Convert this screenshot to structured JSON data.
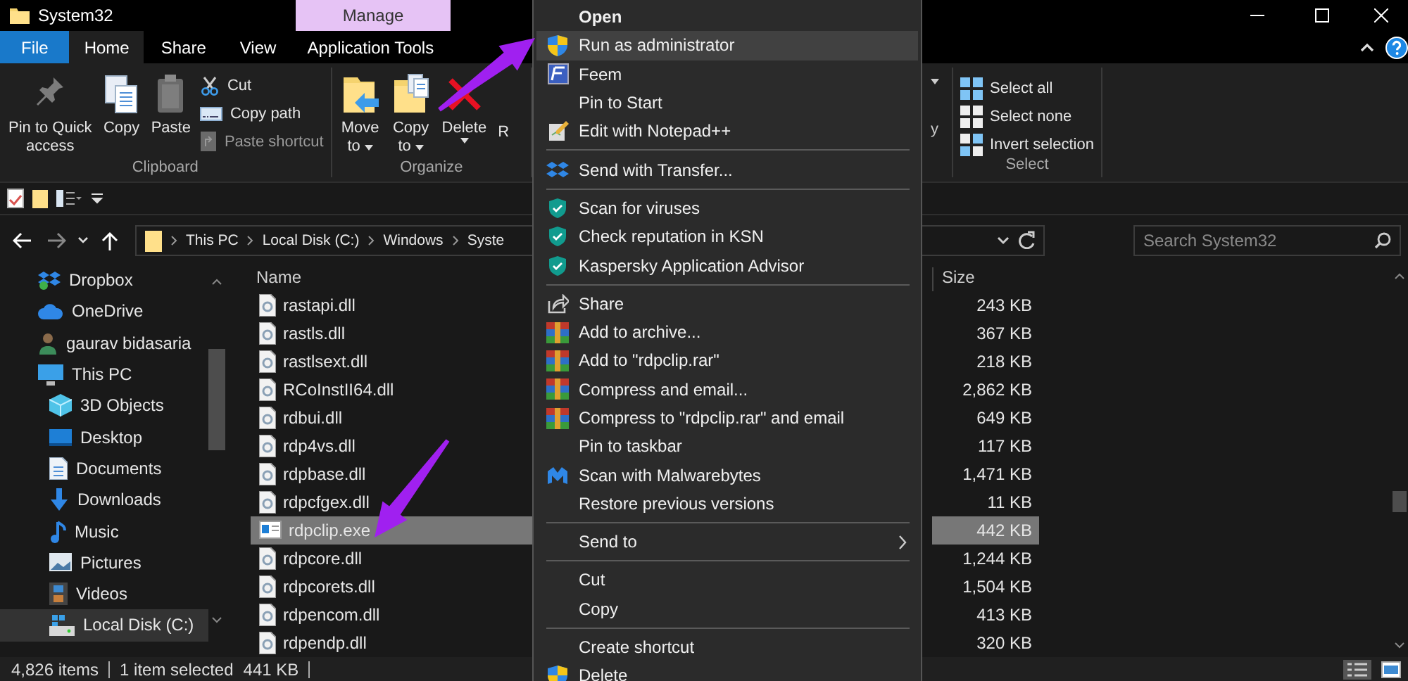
{
  "window": {
    "title": "System32",
    "context_header": "Manage"
  },
  "tabs": [
    {
      "label": "File",
      "kind": "file",
      "selected": false
    },
    {
      "label": "Home",
      "kind": "plain",
      "selected": true
    },
    {
      "label": "Share",
      "kind": "plain",
      "selected": false
    },
    {
      "label": "View",
      "kind": "plain",
      "selected": false
    },
    {
      "label": "Application Tools",
      "kind": "context",
      "selected": false
    }
  ],
  "ribbon": {
    "groups": [
      {
        "label": "Clipboard",
        "large": [
          {
            "label": "Pin to Quick access",
            "kind": "pin",
            "dropdown": false
          },
          {
            "label": "Copy",
            "kind": "copy",
            "dropdown": false
          },
          {
            "label": "Paste",
            "kind": "paste",
            "dropdown": false
          }
        ],
        "small": [
          {
            "label": "Cut",
            "kind": "scissors",
            "disabled": false
          },
          {
            "label": "Copy path",
            "kind": "path",
            "disabled": false
          },
          {
            "label": "Paste shortcut",
            "kind": "shortcut",
            "disabled": true
          }
        ]
      },
      {
        "label": "Organize",
        "large": [
          {
            "label": "Move to",
            "kind": "move",
            "dropdown": true
          },
          {
            "label": "Copy to",
            "kind": "copyto",
            "dropdown": true
          },
          {
            "label": "Delete",
            "kind": "delete",
            "dropdown": true
          },
          {
            "label": "R",
            "kind": "none",
            "dropdown": false
          }
        ]
      }
    ],
    "fragment": "y",
    "right_group": {
      "label": "Select",
      "small": [
        {
          "label": "Select all",
          "kind": "all",
          "disabled": false
        },
        {
          "label": "Select none",
          "kind": "none",
          "disabled": false
        },
        {
          "label": "Invert selection",
          "kind": "invert",
          "disabled": false
        }
      ]
    }
  },
  "address": {
    "crumbs": [
      "This PC",
      "Local Disk (C:)",
      "Windows",
      "Syste"
    ]
  },
  "search": {
    "placeholder": "Search System32"
  },
  "nav": {
    "items": [
      {
        "label": "Dropbox",
        "kind": "dropbox",
        "selected": false
      },
      {
        "label": "OneDrive",
        "kind": "cloud",
        "selected": false
      },
      {
        "label": "gaurav bidasaria",
        "kind": "user",
        "selected": false
      },
      {
        "label": "This PC",
        "kind": "pc",
        "selected": false,
        "children": [
          {
            "label": "3D Objects",
            "kind": "cube",
            "selected": false
          },
          {
            "label": "Desktop",
            "kind": "desktop",
            "selected": false
          },
          {
            "label": "Documents",
            "kind": "document",
            "selected": false
          },
          {
            "label": "Downloads",
            "kind": "download",
            "selected": false
          },
          {
            "label": "Music",
            "kind": "music",
            "selected": false
          },
          {
            "label": "Pictures",
            "kind": "pictures",
            "selected": false
          },
          {
            "label": "Videos",
            "kind": "videos",
            "selected": false
          },
          {
            "label": "Local Disk (C:)",
            "kind": "disk",
            "selected": true
          }
        ]
      }
    ]
  },
  "files": {
    "columns": [
      "Name",
      "Size"
    ],
    "rows": [
      {
        "name": "rastapi.dll",
        "size": "243 KB",
        "kind": "dll",
        "selected": false
      },
      {
        "name": "rastls.dll",
        "size": "367 KB",
        "kind": "dll",
        "selected": false
      },
      {
        "name": "rastlsext.dll",
        "size": "218 KB",
        "kind": "dll",
        "selected": false
      },
      {
        "name": "RCoInstII64.dll",
        "size": "2,862 KB",
        "kind": "dll",
        "selected": false
      },
      {
        "name": "rdbui.dll",
        "size": "649 KB",
        "kind": "dll",
        "selected": false
      },
      {
        "name": "rdp4vs.dll",
        "size": "117 KB",
        "kind": "dll",
        "selected": false
      },
      {
        "name": "rdpbase.dll",
        "size": "1,471 KB",
        "kind": "dll",
        "selected": false
      },
      {
        "name": "rdpcfgex.dll",
        "size": "11 KB",
        "kind": "dll",
        "selected": false
      },
      {
        "name": "rdpclip.exe",
        "size": "442 KB",
        "kind": "exe",
        "selected": true
      },
      {
        "name": "rdpcore.dll",
        "size": "1,244 KB",
        "kind": "dll",
        "selected": false
      },
      {
        "name": "rdpcorets.dll",
        "size": "1,504 KB",
        "kind": "dll",
        "selected": false
      },
      {
        "name": "rdpencom.dll",
        "size": "413 KB",
        "kind": "dll",
        "selected": false
      },
      {
        "name": "rdpendp.dll",
        "size": "320 KB",
        "kind": "dll",
        "selected": false
      }
    ]
  },
  "status": {
    "count": "4,826 items",
    "selection": "1 item selected",
    "size": "441 KB"
  },
  "context_menu": {
    "items": [
      {
        "kind": "default",
        "label": "Open",
        "selected": false
      },
      {
        "kind": "uac",
        "label": "Run as administrator",
        "selected": true
      },
      {
        "kind": "feem",
        "label": "Feem",
        "selected": false
      },
      {
        "kind": "plain",
        "label": "Pin to Start",
        "selected": false
      },
      {
        "kind": "notepad",
        "label": "Edit with Notepad++",
        "selected": false
      },
      {
        "kind": "separator"
      },
      {
        "kind": "dropbox",
        "label": "Send with Transfer...",
        "selected": false
      },
      {
        "kind": "separator"
      },
      {
        "kind": "kaspersky",
        "label": "Scan for viruses",
        "selected": false
      },
      {
        "kind": "kaspersky",
        "label": "Check reputation in KSN",
        "selected": false
      },
      {
        "kind": "kaspersky",
        "label": "Kaspersky Application Advisor",
        "selected": false
      },
      {
        "kind": "separator"
      },
      {
        "kind": "share",
        "label": "Share",
        "selected": false
      },
      {
        "kind": "winrar",
        "label": "Add to archive...",
        "selected": false
      },
      {
        "kind": "winrar",
        "label": "Add to \"rdpclip.rar\"",
        "selected": false
      },
      {
        "kind": "winrar",
        "label": "Compress and email...",
        "selected": false
      },
      {
        "kind": "winrar",
        "label": "Compress to \"rdpclip.rar\" and email",
        "selected": false
      },
      {
        "kind": "plain",
        "label": "Pin to taskbar",
        "selected": false
      },
      {
        "kind": "malwarebytes",
        "label": "Scan with Malwarebytes",
        "selected": false
      },
      {
        "kind": "plain",
        "label": "Restore previous versions",
        "selected": false
      },
      {
        "kind": "separator"
      },
      {
        "kind": "submenu",
        "label": "Send to",
        "selected": false
      },
      {
        "kind": "separator"
      },
      {
        "kind": "plain",
        "label": "Cut",
        "selected": false
      },
      {
        "kind": "plain",
        "label": "Copy",
        "selected": false
      },
      {
        "kind": "separator"
      },
      {
        "kind": "plain",
        "label": "Create shortcut",
        "selected": false
      },
      {
        "kind": "uac",
        "label": "Delete",
        "selected": false
      }
    ]
  },
  "annotations": [
    {
      "kind": "arrow-up-right"
    },
    {
      "kind": "arrow-down-left"
    }
  ]
}
